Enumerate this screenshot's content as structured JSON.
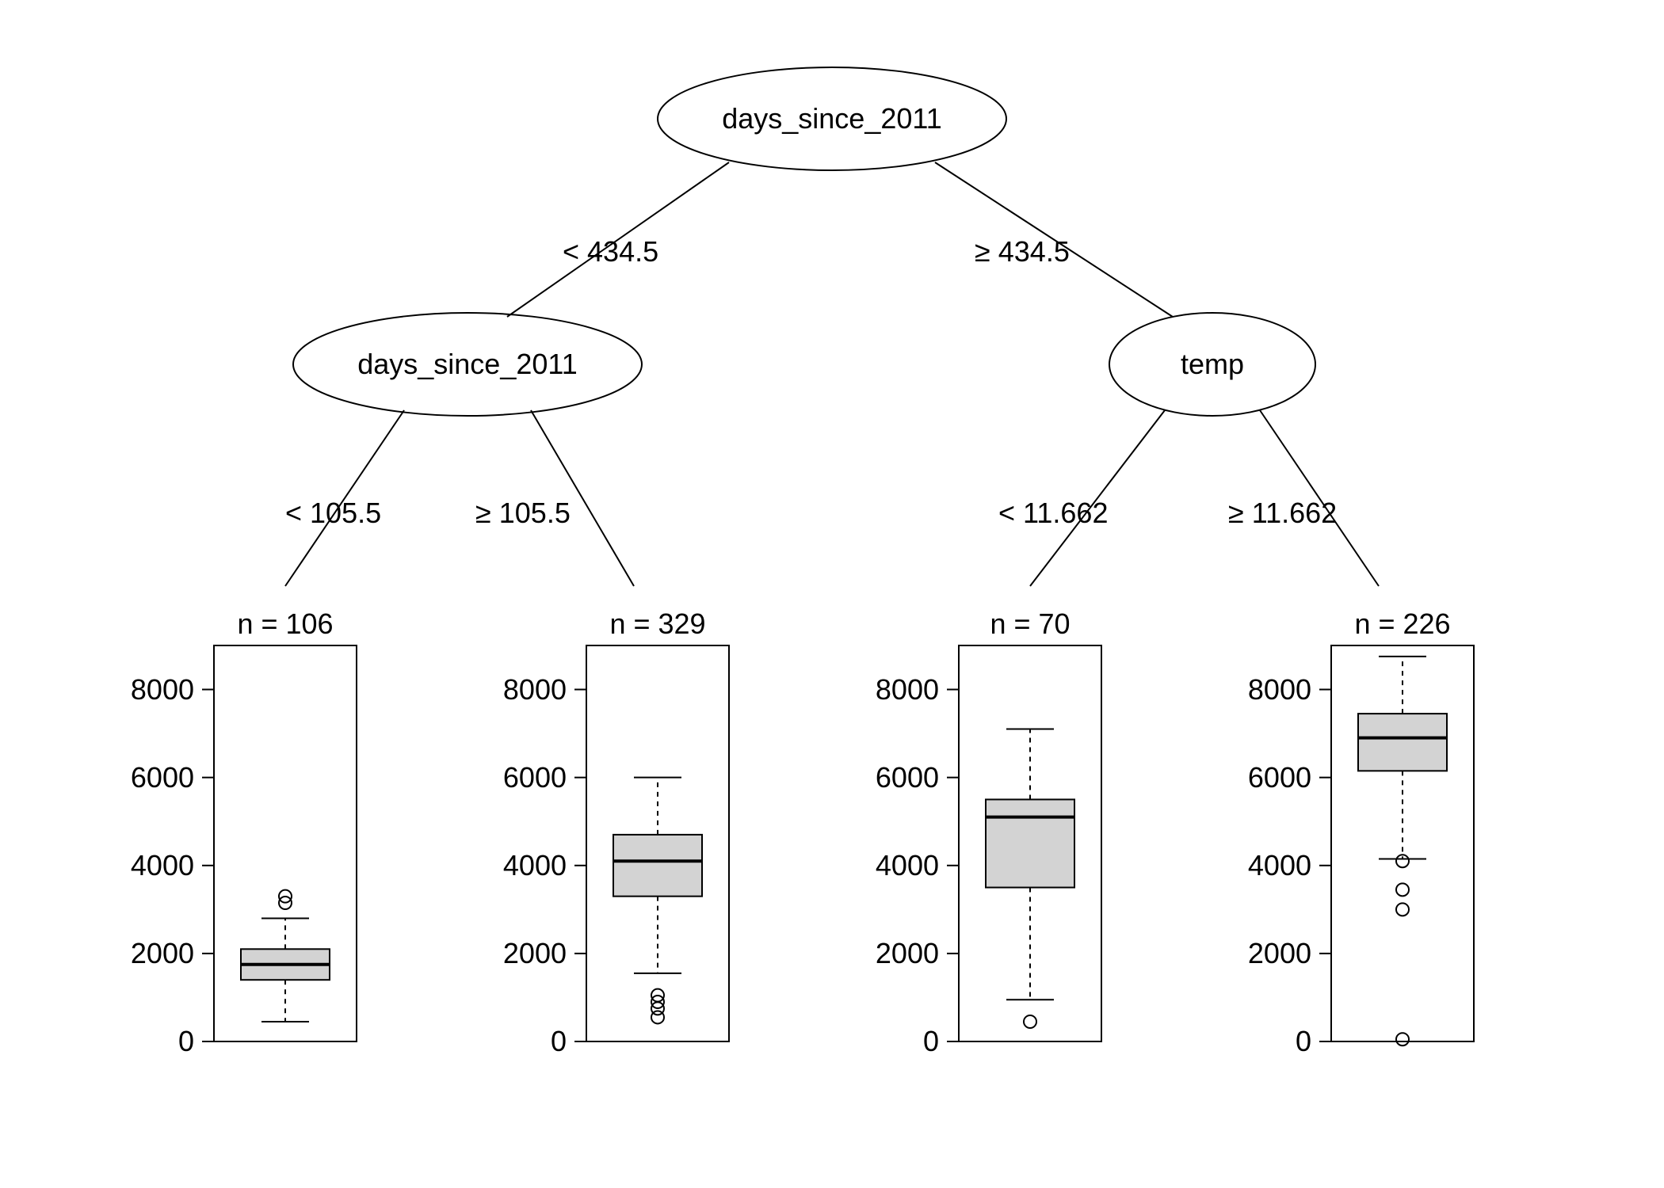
{
  "chart_data": {
    "type": "tree_boxplot",
    "y_axis": {
      "ticks": [
        0,
        2000,
        4000,
        6000,
        8000
      ],
      "range": [
        0,
        9000
      ]
    },
    "root": {
      "label": "days_since_2011",
      "split": 434.5,
      "left_label": "< 434.5",
      "right_label": "≥ 434.5",
      "left": {
        "label": "days_since_2011",
        "split": 105.5,
        "left_label": "< 105.5",
        "right_label": "≥ 105.5",
        "left": {
          "leaf": true,
          "n": 106,
          "box": {
            "min": 450,
            "q1": 1400,
            "median": 1750,
            "q3": 2100,
            "max": 2800,
            "outliers": [
              3150,
              3300
            ]
          }
        },
        "right": {
          "leaf": true,
          "n": 329,
          "box": {
            "min": 1550,
            "q1": 3300,
            "median": 4100,
            "q3": 4700,
            "max": 6000,
            "outliers": [
              1050,
              900,
              750,
              550
            ]
          }
        }
      },
      "right": {
        "label": "temp",
        "split": 11.662,
        "left_label": "< 11.662",
        "right_label": "≥ 11.662",
        "left": {
          "leaf": true,
          "n": 70,
          "box": {
            "min": 950,
            "q1": 3500,
            "median": 5100,
            "q3": 5500,
            "max": 7100,
            "outliers": [
              450
            ]
          }
        },
        "right": {
          "leaf": true,
          "n": 226,
          "box": {
            "min": 4150,
            "q1": 6150,
            "median": 6900,
            "q3": 7450,
            "max": 8750,
            "outliers": [
              4100,
              3450,
              3000,
              50
            ]
          }
        }
      }
    }
  },
  "labels": {
    "root": "days_since_2011",
    "root_left": "< 434.5",
    "root_right": "≥ 434.5",
    "node_left": "days_since_2011",
    "node_left_left": "< 105.5",
    "node_left_right": "≥ 105.5",
    "node_right": "temp",
    "node_right_left": "< 11.662",
    "node_right_right": "≥ 11.662",
    "leaf1_n": "n = 106",
    "leaf2_n": "n = 329",
    "leaf3_n": "n = 70",
    "leaf4_n": "n = 226",
    "tick0": "0",
    "tick2000": "2000",
    "tick4000": "4000",
    "tick6000": "6000",
    "tick8000": "8000"
  }
}
